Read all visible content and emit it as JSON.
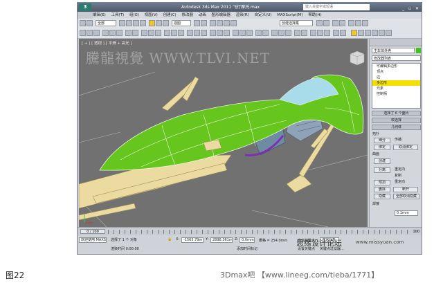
{
  "caption": {
    "figure_label": "图22",
    "source_text": "3Dmax吧  【www.lineeg.com/tieba/1771】"
  },
  "overlay": {
    "forum_watermark": "思缘设计论坛",
    "forum_url": "www.missyuan.com"
  },
  "window": {
    "app_logo": "3",
    "title": "Autodesk 3ds Max  2011    飞行摩托.max",
    "search_placeholder": "键入关键字或短语",
    "controls": "_ ▫ ✕"
  },
  "menu": {
    "items": [
      "编辑(E)",
      "工具(T)",
      "组(G)",
      "视图(V)",
      "创建(C)",
      "修改器",
      "动画",
      "图形编辑器",
      "渲染(R)",
      "自定义(U)",
      "MAXScript(M)",
      "帮助(H)"
    ]
  },
  "toolbar": {
    "selection_filter": "全部",
    "ref_coord": "视图",
    "named_selection": "创建选择集"
  },
  "viewport": {
    "label": "[ + ] [ 透视 ] [ 平滑 + 高光 ]",
    "watermark": "騰龍視覺 WWW.TLVI.NET"
  },
  "panel": {
    "object_name": "主车体外壳",
    "modifier_list": "修改器列表",
    "stack_items": [
      {
        "label": "可编辑多边形",
        "selected": false
      },
      {
        "label": "顶点",
        "selected": false
      },
      {
        "label": "边",
        "selected": false
      },
      {
        "label": "多边形",
        "selected": true
      },
      {
        "label": "元素",
        "selected": false
      },
      {
        "label": "控制柄",
        "selected": false
      }
    ],
    "selection_header": "选择了 6 个面片",
    "soft_selection": "软选择",
    "geometry_rollout": "几何体",
    "topology_label": "拓扑",
    "subdivide_label": "细分",
    "propagate_label": "传播",
    "bind_label": "绑定",
    "unbind_label": "取消绑定",
    "surface_label": "曲面",
    "create_label": "创建",
    "detach_label": "分离",
    "reorient_label": "重定向",
    "copy_label": "复制",
    "attach_label": "附加",
    "reorient2_label": "重定向",
    "delete_label": "删除",
    "break_label": "断开",
    "hide_label": "隐藏",
    "unhide_all_label": "全部取消隐藏",
    "weld_label": "焊接",
    "weld_threshold": "0.1mm"
  },
  "timeline": {
    "frame_slider": "0 / 100",
    "end_label": "100"
  },
  "status": {
    "script_field": "欢迎使用 MAXSc",
    "selection_text": "选择了 1 个 对象",
    "x_value": "-1565.79m",
    "y_value": "2898.361m",
    "z_value": "0.0mm",
    "grid_text": "栅格 = 254.0mm",
    "autokey_label": "自动关键点",
    "selected_label": "选定对象",
    "render_time": "渲染时间 0:00:00",
    "time_tag": "添加时间标记",
    "set_key": "设置关键点",
    "key_filter": "关键点过滤器..."
  },
  "colors": {
    "body_green": "#67c61d",
    "frame_beige": "#ecdba0",
    "viewport_bg": "#717171",
    "selected_yellow": "#f2e000"
  }
}
